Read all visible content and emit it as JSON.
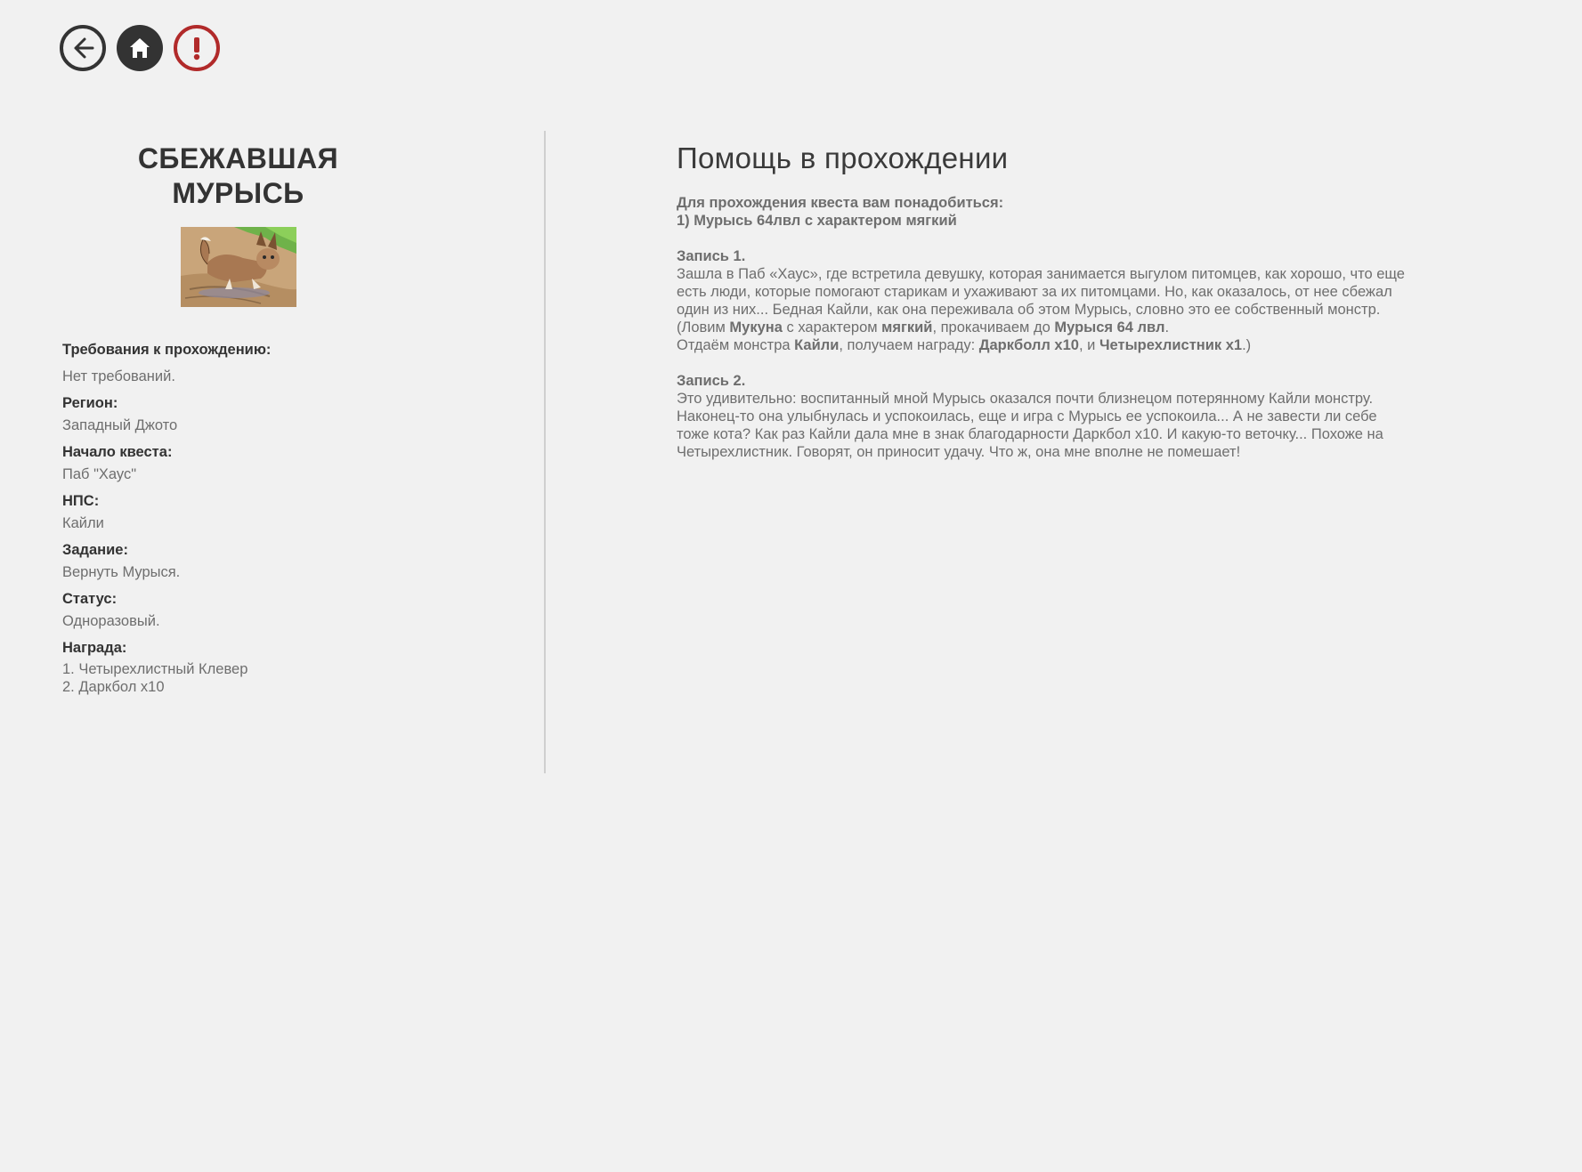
{
  "nav": {
    "back_icon": "arrow-left-icon",
    "home_icon": "home-icon",
    "alert_icon": "exclamation-icon",
    "colors": {
      "dark": "#333333",
      "alert": "#b12a2a"
    }
  },
  "quest": {
    "title_line1": "СБЕЖАВШАЯ",
    "title_line2": "МУРЫСЬ",
    "image_icon": "lynx-creature-image",
    "requirements_label": "Требования к прохождению:",
    "requirements_value": "Нет требований.",
    "region_label": "Регион:",
    "region_value": "Западный Джото",
    "start_label": "Начало квеста:",
    "start_value": "Паб \"Хаус\"",
    "npc_label": "НПС:",
    "npc_value": "Кайли",
    "task_label": "Задание:",
    "task_value": "Вернуть Мурыся.",
    "status_label": "Статус:",
    "status_value": "Одноразовый.",
    "reward_label": "Награда:",
    "rewards": [
      "1.  Четырехлистный Клевер",
      "2.  Даркбол x10"
    ]
  },
  "help": {
    "title": "Помощь в прохождении",
    "needs_line1": "Для прохождения квеста вам понадобиться:",
    "needs_line2": "1) Мурысь 64лвл с характером мягкий",
    "entry1_title": "Запись 1.",
    "entry1_text": "Зашла в Паб «Хаус», где встретила девушку, которая занимается выгулом питомцев, как хорошо, что еще есть люди, которые помогают старикам и ухаживают за их питомцами. Но, как оказалось, от нее сбежал один из них... Бедная Кайли, как она переживала об этом Мурысь, словно это ее собственный монстр.",
    "instr1": {
      "p1": "(Ловим ",
      "b1": "Мукуна",
      "p2": " с характером ",
      "b2": "мягкий",
      "p3": ", прокачиваем до ",
      "b3": "Мурыся 64 лвл",
      "p4": "."
    },
    "instr2": {
      "p1": "Отдаём монстра ",
      "b1": "Кайли",
      "p2": ", получаем награду: ",
      "b2": "Даркболл x10",
      "p3": ", и ",
      "b3": "Четырехлистник x1",
      "p4": ".)"
    },
    "entry2_title": "Запись 2.",
    "entry2_text": "Это удивительно: воспитанный мной Мурысь оказался почти близнецом потерянному Кайли монстру. Наконец-то она улыбнулась и успокоилась, еще и игра с Мурысь ее успокоила... А не завести ли себе тоже кота? Как раз Кайли дала мне в знак благодарности Даркбол x10. И какую-то веточку... Похоже на Четырехлистник. Говорят, он приносит удачу. Что ж, она мне вполне не помешает!"
  }
}
